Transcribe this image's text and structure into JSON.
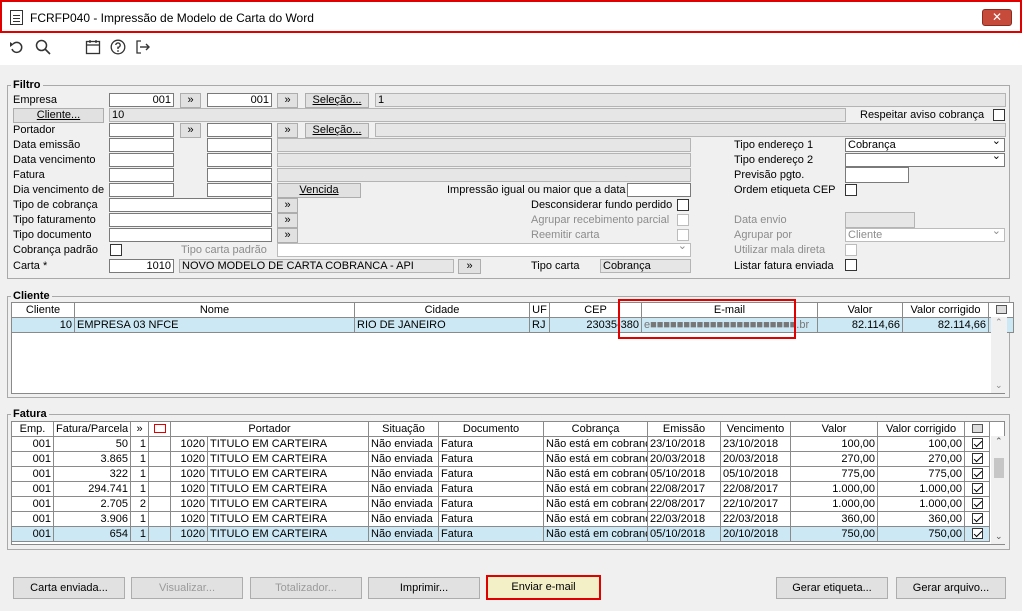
{
  "window": {
    "title": "FCRFP040 - Impressão de Modelo de Carta do Word",
    "close_label": "✕"
  },
  "toolbar": {
    "icons": [
      "undo-icon",
      "search-icon",
      "calendar-icon",
      "help-icon",
      "exit-icon"
    ]
  },
  "filtro": {
    "label": "Filtro",
    "empresa_label": "Empresa",
    "empresa_from": "001",
    "empresa_to": "001",
    "empresa_desc": "1",
    "selecao_label": "Seleção...",
    "cliente_button": "Cliente...",
    "cliente_value": "10",
    "respeitar_label": "Respeitar aviso cobrança",
    "portador_label": "Portador",
    "data_emissao_label": "Data emissão",
    "data_vencimento_label": "Data vencimento",
    "fatura_label": "Fatura",
    "dia_vencimento_label": "Dia vencimento de",
    "vencida_button": "Vencida",
    "impressao_label": "Impressão igual ou maior que a data",
    "tipo_cobranca_label": "Tipo de cobrança",
    "tipo_faturamento_label": "Tipo faturamento",
    "tipo_documento_label": "Tipo documento",
    "cobranca_padrao_label": "Cobrança padrão",
    "tipo_carta_padrao_label": "Tipo carta padrão",
    "carta_label": "Carta *",
    "carta_code": "1010",
    "carta_desc": "NOVO MODELO DE CARTA COBRANCA - API",
    "desconsiderar_label": "Desconsiderar fundo perdido",
    "agrupar_recebimento_label": "Agrupar recebimento parcial",
    "reemitir_label": "Reemitir carta",
    "tipo_carta_label": "Tipo carta",
    "tipo_carta_value": "Cobrança",
    "tipo_endereco1_label": "Tipo endereço 1",
    "tipo_endereco1_value": "Cobrança",
    "tipo_endereco2_label": "Tipo endereço 2",
    "previsao_label": "Previsão pgto.",
    "ordem_etiqueta_label": "Ordem etiqueta CEP",
    "data_envio_label": "Data envio",
    "agrupar_por_label": "Agrupar por",
    "agrupar_por_value": "Cliente",
    "utilizar_mala_label": "Utilizar mala direta",
    "listar_fatura_label": "Listar fatura enviada",
    "arrow": "»"
  },
  "cliente": {
    "label": "Cliente",
    "columns": [
      "Cliente",
      "Nome",
      "Cidade",
      "UF",
      "CEP",
      "E-mail",
      "Valor",
      "Valor corrigido"
    ],
    "rows": [
      [
        "10",
        "EMPRESA 03 NFCE",
        "RIO DE JANEIRO",
        "RJ",
        "23035-380",
        "e■■■■■■■■■■■■■■■■■■■■■■.br",
        "82.114,66",
        "82.114,66"
      ]
    ]
  },
  "fatura": {
    "label": "Fatura",
    "columns": [
      "Emp.",
      "Fatura/Parcela",
      "»",
      "",
      "Portador",
      "Situação",
      "Documento",
      "Cobrança",
      "Emissão",
      "Vencimento",
      "Valor",
      "Valor corrigido"
    ],
    "rows": [
      [
        "001",
        "50",
        "1",
        "1020",
        "TITULO EM CARTEIRA",
        "Não enviada",
        "Fatura",
        "Não está em cobranç",
        "23/10/2018",
        "23/10/2018",
        "100,00",
        "100,00"
      ],
      [
        "001",
        "3.865",
        "1",
        "1020",
        "TITULO EM CARTEIRA",
        "Não enviada",
        "Fatura",
        "Não está em cobranç",
        "20/03/2018",
        "20/03/2018",
        "270,00",
        "270,00"
      ],
      [
        "001",
        "322",
        "1",
        "1020",
        "TITULO EM CARTEIRA",
        "Não enviada",
        "Fatura",
        "Não está em cobranç",
        "05/10/2018",
        "05/10/2018",
        "775,00",
        "775,00"
      ],
      [
        "001",
        "294.741",
        "1",
        "1020",
        "TITULO EM CARTEIRA",
        "Não enviada",
        "Fatura",
        "Não está em cobranç",
        "22/08/2017",
        "22/08/2017",
        "1.000,00",
        "1.000,00"
      ],
      [
        "001",
        "2.705",
        "2",
        "1020",
        "TITULO EM CARTEIRA",
        "Não enviada",
        "Fatura",
        "Não está em cobranç",
        "22/08/2017",
        "22/10/2017",
        "1.000,00",
        "1.000,00"
      ],
      [
        "001",
        "3.906",
        "1",
        "1020",
        "TITULO EM CARTEIRA",
        "Não enviada",
        "Fatura",
        "Não está em cobranç",
        "22/03/2018",
        "22/03/2018",
        "360,00",
        "360,00"
      ],
      [
        "001",
        "654",
        "1",
        "1020",
        "TITULO EM CARTEIRA",
        "Não enviada",
        "Fatura",
        "Não está em cobranç",
        "05/10/2018",
        "20/10/2018",
        "750,00",
        "750,00"
      ]
    ]
  },
  "buttons": {
    "carta_enviada": "Carta enviada...",
    "visualizar": "Visualizar...",
    "totalizador": "Totalizador...",
    "imprimir": "Imprimir...",
    "enviar_email": "Enviar e-mail",
    "gerar_etiqueta": "Gerar etiqueta...",
    "gerar_arquivo": "Gerar arquivo..."
  },
  "colors": {
    "selected_row": "#cce8f4",
    "highlight_border": "#e00000",
    "send_button": "#f3f0c8"
  }
}
